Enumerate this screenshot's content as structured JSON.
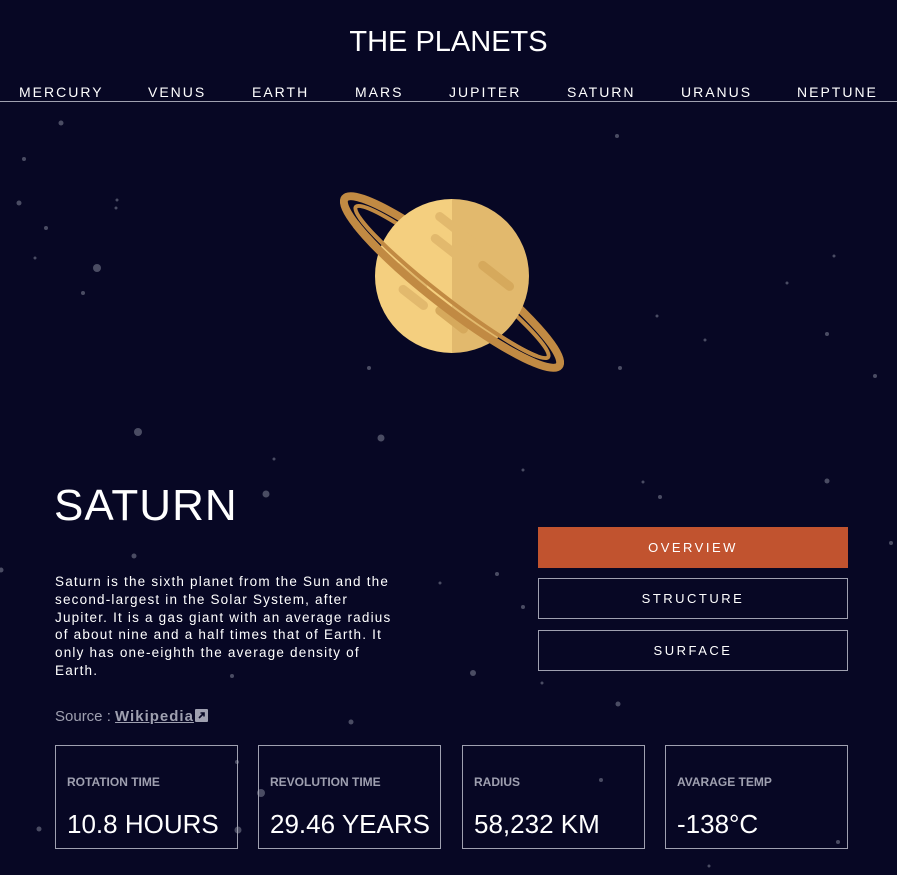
{
  "header": {
    "title": "THE PLANETS"
  },
  "nav": {
    "items": [
      {
        "label": "MERCURY"
      },
      {
        "label": "VENUS"
      },
      {
        "label": "EARTH"
      },
      {
        "label": "MARS"
      },
      {
        "label": "JUPITER"
      },
      {
        "label": "SATURN"
      },
      {
        "label": "URANUS"
      },
      {
        "label": "NEPTUNE"
      }
    ]
  },
  "planet": {
    "name": "SATURN",
    "description": "Saturn is the sixth planet from the Sun and the second-largest in the Solar System, after Jupiter. It is a gas giant with an average radius of about nine and a half times that of Earth. It only has one-eighth the average density of Earth.",
    "source_prefix": "Source : ",
    "source_link": "Wikipedia",
    "source_icon": "external-link-icon"
  },
  "tabs": [
    {
      "label": "OVERVIEW",
      "active": true
    },
    {
      "label": "STRUCTURE",
      "active": false
    },
    {
      "label": "SURFACE",
      "active": false
    }
  ],
  "stats": [
    {
      "label": "ROTATION TIME",
      "value": "10.8 HOURS"
    },
    {
      "label": "REVOLUTION TIME",
      "value": "29.46 YEARS"
    },
    {
      "label": "RADIUS",
      "value": "58,232 KM"
    },
    {
      "label": "AVARAGE TEMP",
      "value": "-138°C"
    }
  ],
  "colors": {
    "background": "#070724",
    "accent": "#c1532f",
    "border": "#9fa0b0",
    "planet_light": "#f4cf7f",
    "planet_shade": "#e2b96d",
    "ring": "#c18a43"
  }
}
